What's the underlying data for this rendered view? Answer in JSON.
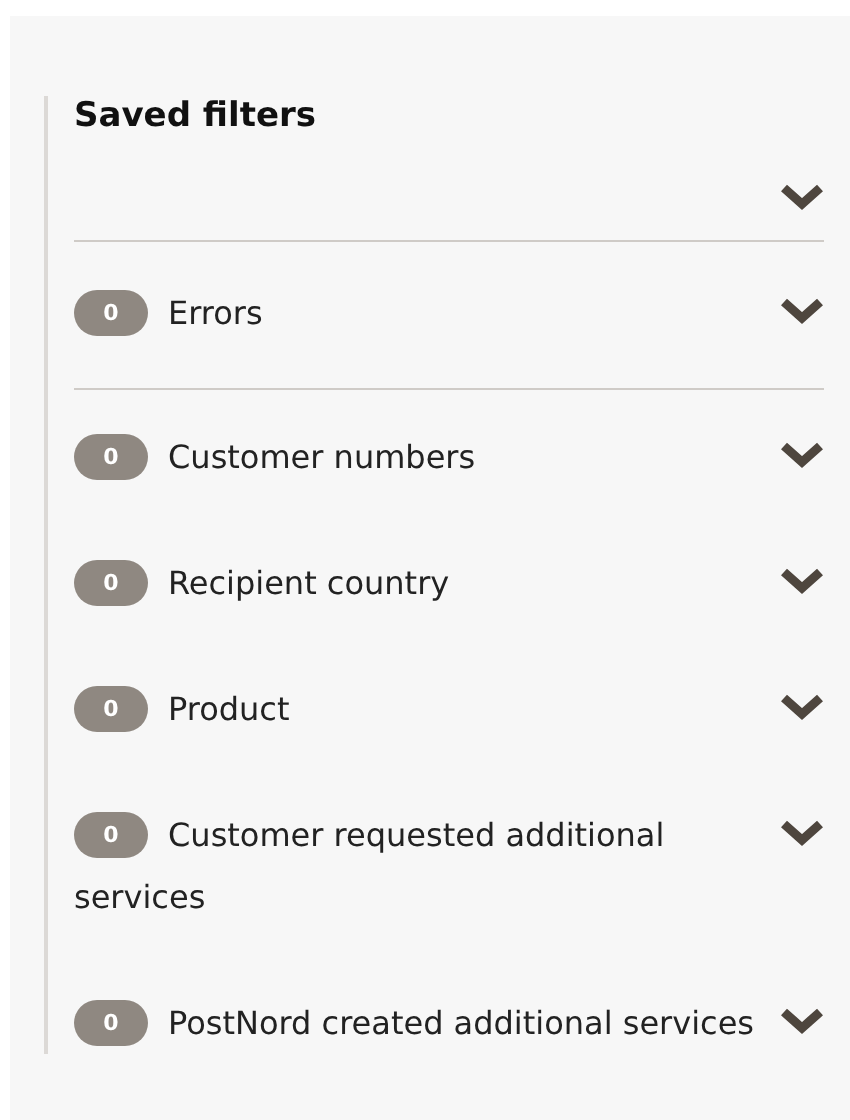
{
  "panel": {
    "title": "Saved filters",
    "groups": [
      {
        "filters": [
          {
            "count": "0",
            "label": "Errors"
          }
        ]
      },
      {
        "filters": [
          {
            "count": "0",
            "label": "Customer numbers"
          },
          {
            "count": "0",
            "label": "Recipient country"
          },
          {
            "count": "0",
            "label": "Product"
          },
          {
            "count": "0",
            "label": "Customer requested additional services"
          },
          {
            "count": "0",
            "label": "PostNord created additional services"
          }
        ]
      }
    ]
  }
}
